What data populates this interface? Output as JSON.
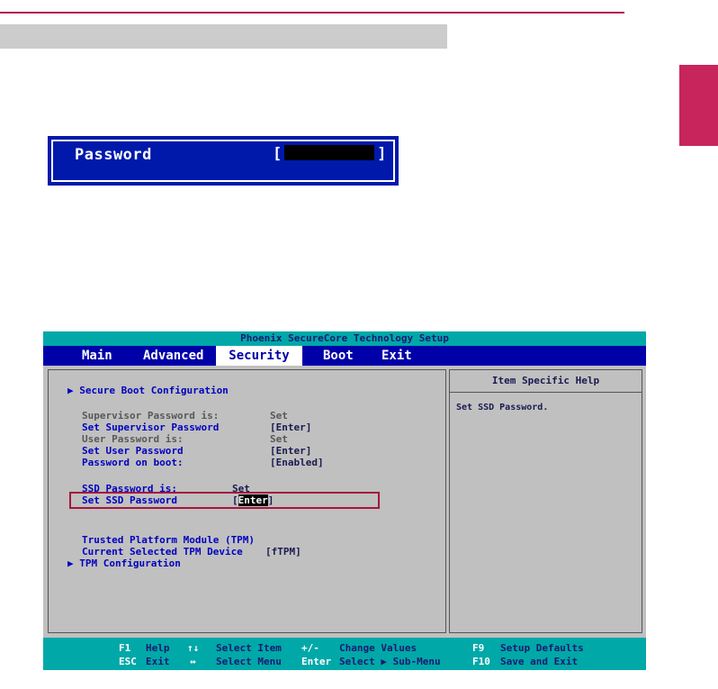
{
  "password_prompt": {
    "label": "Password",
    "open_bracket": "[",
    "close_bracket": "]"
  },
  "bios": {
    "title": "Phoenix SecureCore Technology Setup",
    "menu": [
      "Main",
      "Advanced",
      "Security",
      "Boot",
      "Exit"
    ],
    "active_menu": "Security",
    "items": {
      "secure_boot": "▶ Secure Boot Configuration",
      "supervisor_pw_is_label": "Supervisor Password is:",
      "supervisor_pw_is_value": "Set",
      "set_supervisor_label": "Set Supervisor Password",
      "set_supervisor_value": "[Enter]",
      "user_pw_is_label": "User Password is:",
      "user_pw_is_value": "Set",
      "set_user_label": "Set User Password",
      "set_user_value": "[Enter]",
      "pw_on_boot_label": "Password on boot:",
      "pw_on_boot_value": "[Enabled]",
      "ssd_pw_is_label": "SSD Password is:",
      "ssd_pw_is_value": "Set",
      "set_ssd_label": "Set SSD Password",
      "set_ssd_value": "Enter",
      "tpm_label": "Trusted Platform Module (TPM)",
      "tpm_device_label": "Current Selected TPM Device",
      "tpm_device_value": "[fTPM]",
      "tpm_config": "▶ TPM Configuration"
    },
    "help": {
      "title": "Item Specific Help",
      "text": "Set SSD Password."
    },
    "footer": {
      "f1": "F1",
      "help": "Help",
      "arrows_ud": "↑↓",
      "select_item": "Select Item",
      "plusminus": "+/-",
      "change_values": "Change Values",
      "f9": "F9",
      "setup_defaults": "Setup Defaults",
      "esc": "ESC",
      "exit": "Exit",
      "arrows_lr": "↔",
      "select_menu": "Select Menu",
      "enter": "Enter",
      "select_submenu": "Select ▶ Sub-Menu",
      "f10": "F10",
      "save_exit": "Save and Exit"
    }
  },
  "colors": {
    "accent": "#b0134f",
    "side_tab": "#c8255d",
    "bios_blue": "#0000a8",
    "bios_cyan": "#00a8a8",
    "bios_grey": "#c0c0c0",
    "prompt_blue": "#0019ab"
  }
}
